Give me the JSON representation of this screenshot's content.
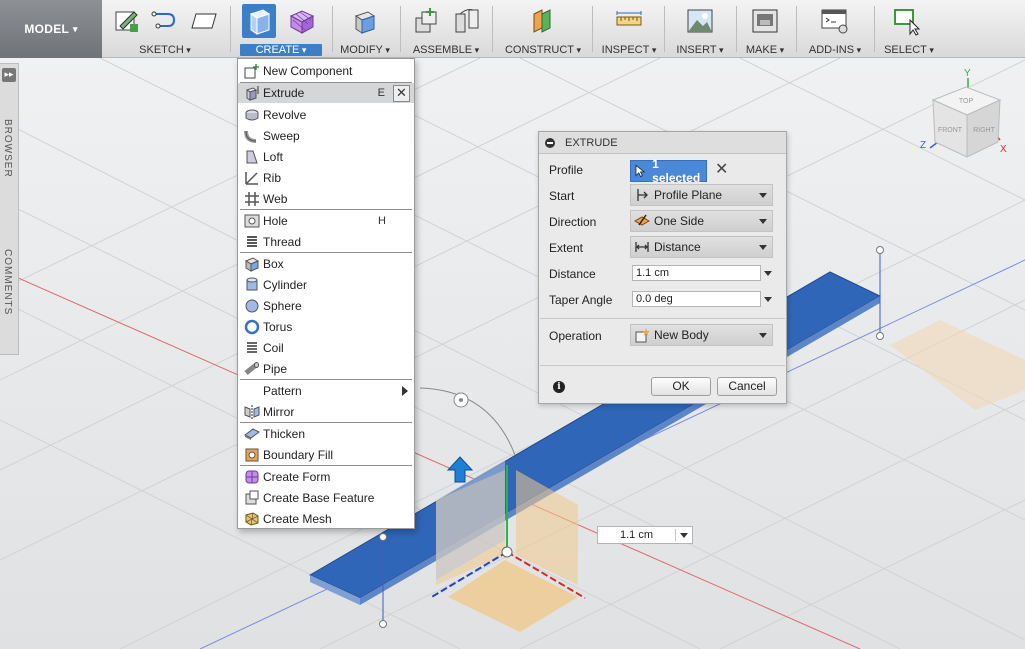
{
  "toolbar": {
    "workspace": "MODEL",
    "groups": [
      {
        "label": "SKETCH"
      },
      {
        "label": "CREATE"
      },
      {
        "label": "MODIFY"
      },
      {
        "label": "ASSEMBLE"
      },
      {
        "label": "CONSTRUCT"
      },
      {
        "label": "INSPECT"
      },
      {
        "label": "INSERT"
      },
      {
        "label": "MAKE"
      },
      {
        "label": "ADD-INS"
      },
      {
        "label": "SELECT"
      }
    ],
    "active_group": "CREATE",
    "accent_color": "#3c7fc6"
  },
  "side_panels": {
    "toggle": "▸▸",
    "browser": "BROWSER",
    "comments": "COMMENTS"
  },
  "create_menu": {
    "items": [
      {
        "label": "New Component",
        "icon": "new-component-icon"
      },
      {
        "label": "Extrude",
        "shortcut": "E",
        "icon": "extrude-icon",
        "highlighted": true
      },
      {
        "label": "Revolve",
        "icon": "revolve-icon"
      },
      {
        "label": "Sweep",
        "icon": "sweep-icon"
      },
      {
        "label": "Loft",
        "icon": "loft-icon"
      },
      {
        "label": "Rib",
        "icon": "rib-icon"
      },
      {
        "label": "Web",
        "icon": "web-icon"
      },
      {
        "label": "Hole",
        "shortcut": "H",
        "icon": "hole-icon"
      },
      {
        "label": "Thread",
        "icon": "thread-icon"
      },
      {
        "label": "Box",
        "icon": "box-icon"
      },
      {
        "label": "Cylinder",
        "icon": "cylinder-icon"
      },
      {
        "label": "Sphere",
        "icon": "sphere-icon"
      },
      {
        "label": "Torus",
        "icon": "torus-icon"
      },
      {
        "label": "Coil",
        "icon": "coil-icon"
      },
      {
        "label": "Pipe",
        "icon": "pipe-icon"
      },
      {
        "label": "Pattern",
        "icon": "",
        "submenu": true
      },
      {
        "label": "Mirror",
        "icon": "mirror-icon"
      },
      {
        "label": "Thicken",
        "icon": "thicken-icon"
      },
      {
        "label": "Boundary Fill",
        "icon": "boundary-fill-icon"
      },
      {
        "label": "Create Form",
        "icon": "create-form-icon"
      },
      {
        "label": "Create Base Feature",
        "icon": "create-base-feature-icon"
      },
      {
        "label": "Create Mesh",
        "icon": "create-mesh-icon"
      }
    ],
    "close_glyph": "✕"
  },
  "extrude_dialog": {
    "title": "EXTRUDE",
    "profile": {
      "label": "Profile",
      "value": "1 selected",
      "clear": "✕"
    },
    "start": {
      "label": "Start",
      "value": "Profile Plane"
    },
    "direction": {
      "label": "Direction",
      "value": "One Side"
    },
    "extent": {
      "label": "Extent",
      "value": "Distance"
    },
    "distance": {
      "label": "Distance",
      "value": "1.1 cm"
    },
    "taper_angle": {
      "label": "Taper Angle",
      "value": "0.0 deg"
    },
    "operation": {
      "label": "Operation",
      "value": "New Body"
    },
    "info": "i",
    "ok": "OK",
    "cancel": "Cancel"
  },
  "viewport": {
    "distance_value": "1.1 cm",
    "viewcube": {
      "top": "TOP",
      "front": "FRONT",
      "right": "RIGHT"
    },
    "axes": {
      "x": "X",
      "y": "Y",
      "z": "Z"
    },
    "body_color": "#2f66b8"
  }
}
